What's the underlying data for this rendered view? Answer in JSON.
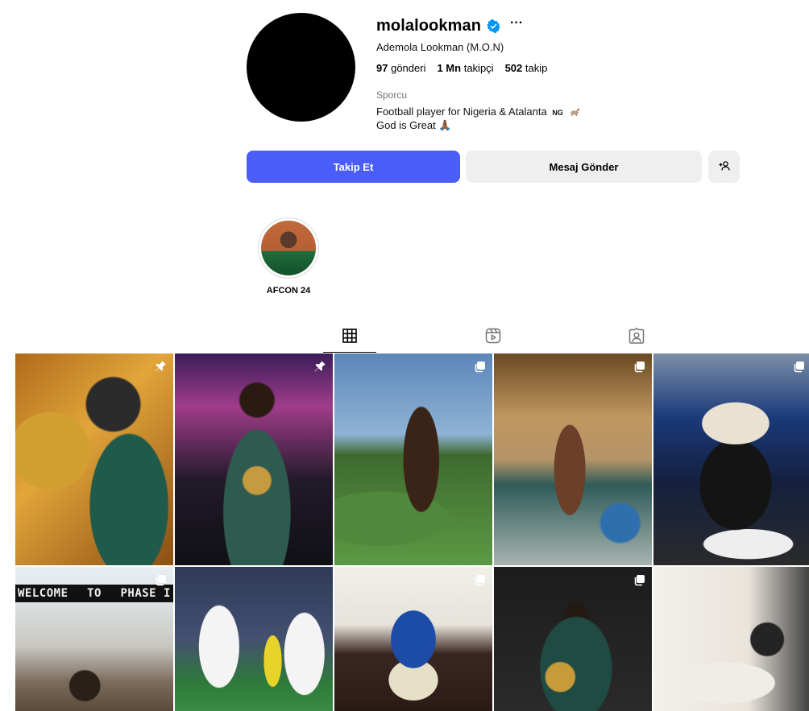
{
  "profile": {
    "username": "molalookman",
    "more_label": "···",
    "full_name": "Ademola Lookman (M.O.N)",
    "posts_count": "97",
    "posts_label": "gönderi",
    "followers_count": "1 Mn",
    "followers_label": "takipçi",
    "following_count": "502",
    "following_label": "takip",
    "category": "Sporcu",
    "bio_line1": "Football player for Nigeria & Atalanta",
    "bio_flag": "NG",
    "bio_line2": "God is Great 🙏🏾"
  },
  "actions": {
    "follow_label": "Takip Et",
    "message_label": "Mesaj Gönder",
    "suggest_icon": "person-add-icon"
  },
  "highlights": [
    {
      "label": "AFCON 24"
    }
  ],
  "tabs": {
    "posts_icon": "grid-icon",
    "reels_icon": "reels-icon",
    "tagged_icon": "tagged-icon",
    "active": "posts"
  },
  "posts": [
    {
      "badge": "pin-icon"
    },
    {
      "badge": "pin-icon"
    },
    {
      "badge": "carousel-icon"
    },
    {
      "badge": "carousel-icon"
    },
    {
      "badge": "carousel-icon"
    },
    {
      "badge": "carousel-icon",
      "sign_left": "WELCOME",
      "sign_mid": "TO",
      "sign_right": "PHASE I"
    },
    {
      "badge": ""
    },
    {
      "badge": "carousel-icon"
    },
    {
      "badge": "carousel-icon"
    },
    {
      "badge": ""
    }
  ],
  "colors": {
    "follow_button": "#4a5df9",
    "secondary_button": "#efefef",
    "verified": "#0095f6",
    "muted_text": "#737373"
  }
}
